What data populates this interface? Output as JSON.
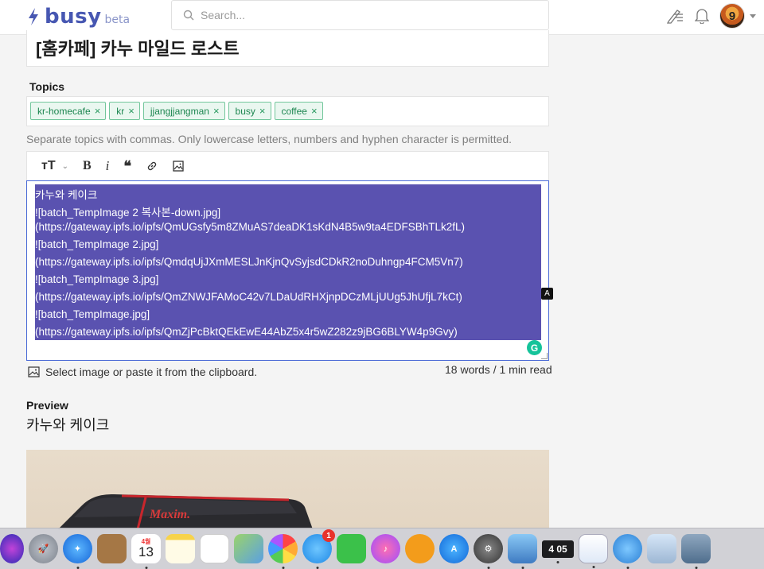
{
  "header": {
    "logo_name": "busy",
    "logo_beta": "beta",
    "search_placeholder": "Search...",
    "avatar_text": "9"
  },
  "editor": {
    "title": "[홈카페] 카누 마일드 로스트",
    "topics_label": "Topics",
    "topics": [
      "kr-homecafe",
      "kr",
      "jjangjjangman",
      "busy",
      "coffee"
    ],
    "hint": "Separate topics with commas. Only lowercase letters, numbers and hyphen character is permitted.",
    "body_lines": [
      "카누와 케이크",
      "![batch_TempImage 2 복사본-down.jpg]",
      "(https://gateway.ipfs.io/ipfs/QmUGsfy5m8ZMuAS7deaDK1sKdN4B5w9ta4EDFSBhTLk2fL)",
      "![batch_TempImage 2.jpg]",
      "(https://gateway.ipfs.io/ipfs/QmdqUjJXmMESLJnKjnQvSyjsdCDkR2noDuhngp4FCM5Vn7)",
      "![batch_TempImage 3.jpg]",
      "(https://gateway.ipfs.io/ipfs/QmZNWJFAMoC42v7LDaUdRHXjnpDCzMLjUUg5JhUfjL7kCt)",
      "![batch_TempImage.jpg]",
      "(https://gateway.ipfs.io/ipfs/QmZjPcBktQEkEwE44AbZ5x4r5wZ282z9jBG6BLYW4p9Gvy)"
    ],
    "toolbar": {
      "heading": "тT",
      "bold": "B",
      "italic": "i",
      "quote": "“"
    },
    "grammarly_text": "G",
    "badge_a": "A",
    "select_image_text": "Select image or paste it from the clipboard.",
    "word_count": "18 words / 1 min read"
  },
  "preview": {
    "label": "Preview",
    "title": "카누와 케이크",
    "image_brand": "Maxim."
  },
  "dock": {
    "calendar_month": "4월",
    "calendar_day": "13",
    "messages_badge": "1",
    "clock_text": "4 05"
  },
  "colors": {
    "brand": "#4757b2",
    "selection": "#5a52b0",
    "tag_border": "#72c69b",
    "tag_text": "#1d8650"
  }
}
